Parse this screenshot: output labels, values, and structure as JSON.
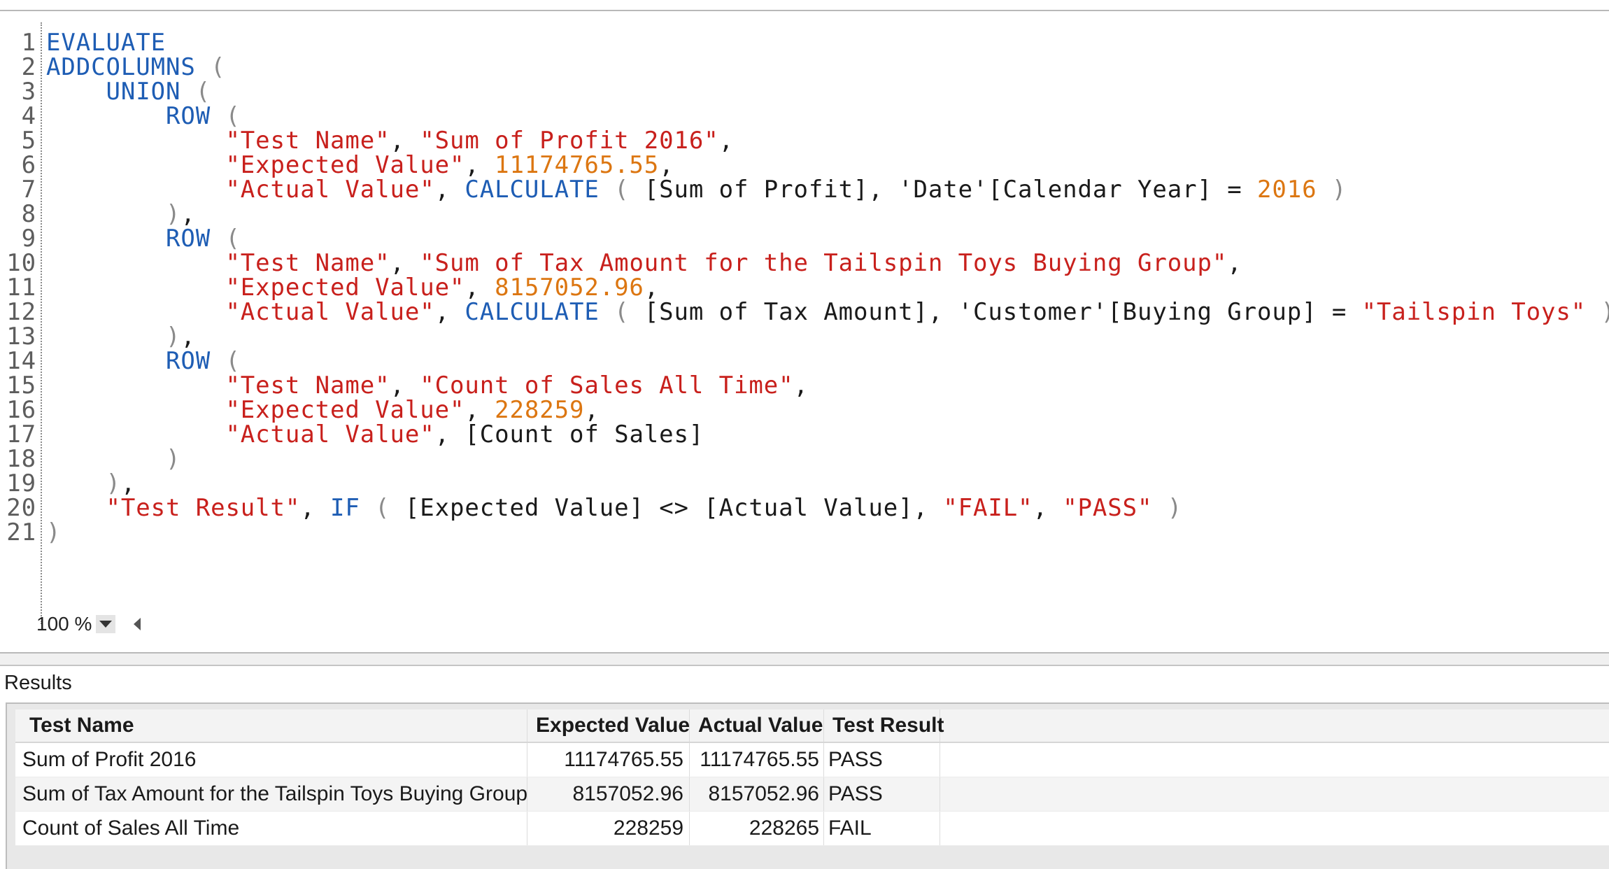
{
  "editor": {
    "lines": [
      [
        {
          "t": "EVALUATE",
          "c": "kw"
        }
      ],
      [
        {
          "t": "ADDCOLUMNS",
          "c": "kw"
        },
        {
          "t": " (",
          "c": "pg"
        }
      ],
      [
        {
          "t": "    ",
          "c": "pn"
        },
        {
          "t": "UNION",
          "c": "kw"
        },
        {
          "t": " (",
          "c": "pg"
        }
      ],
      [
        {
          "t": "        ",
          "c": "pn"
        },
        {
          "t": "ROW",
          "c": "kw"
        },
        {
          "t": " (",
          "c": "pg"
        }
      ],
      [
        {
          "t": "            ",
          "c": "pn"
        },
        {
          "t": "\"Test Name\"",
          "c": "str"
        },
        {
          "t": ", ",
          "c": "pn"
        },
        {
          "t": "\"Sum of Profit 2016\"",
          "c": "str"
        },
        {
          "t": ",",
          "c": "pn"
        }
      ],
      [
        {
          "t": "            ",
          "c": "pn"
        },
        {
          "t": "\"Expected Value\"",
          "c": "str"
        },
        {
          "t": ", ",
          "c": "pn"
        },
        {
          "t": "11174765.55",
          "c": "nm"
        },
        {
          "t": ",",
          "c": "pn"
        }
      ],
      [
        {
          "t": "            ",
          "c": "pn"
        },
        {
          "t": "\"Actual Value\"",
          "c": "str"
        },
        {
          "t": ", ",
          "c": "pn"
        },
        {
          "t": "CALCULATE",
          "c": "kw"
        },
        {
          "t": " ( ",
          "c": "pg"
        },
        {
          "t": "[Sum of Profit], 'Date'[Calendar Year] = ",
          "c": "pn"
        },
        {
          "t": "2016",
          "c": "nm"
        },
        {
          "t": " )",
          "c": "pg"
        }
      ],
      [
        {
          "t": "        ",
          "c": "pn"
        },
        {
          "t": ")",
          "c": "pg"
        },
        {
          "t": ",",
          "c": "pn"
        }
      ],
      [
        {
          "t": "        ",
          "c": "pn"
        },
        {
          "t": "ROW",
          "c": "kw"
        },
        {
          "t": " (",
          "c": "pg"
        }
      ],
      [
        {
          "t": "            ",
          "c": "pn"
        },
        {
          "t": "\"Test Name\"",
          "c": "str"
        },
        {
          "t": ", ",
          "c": "pn"
        },
        {
          "t": "\"Sum of Tax Amount for the Tailspin Toys Buying Group\"",
          "c": "str"
        },
        {
          "t": ",",
          "c": "pn"
        }
      ],
      [
        {
          "t": "            ",
          "c": "pn"
        },
        {
          "t": "\"Expected Value\"",
          "c": "str"
        },
        {
          "t": ", ",
          "c": "pn"
        },
        {
          "t": "8157052.96",
          "c": "nm"
        },
        {
          "t": ",",
          "c": "pn"
        }
      ],
      [
        {
          "t": "            ",
          "c": "pn"
        },
        {
          "t": "\"Actual Value\"",
          "c": "str"
        },
        {
          "t": ", ",
          "c": "pn"
        },
        {
          "t": "CALCULATE",
          "c": "kw"
        },
        {
          "t": " ( ",
          "c": "pg"
        },
        {
          "t": "[Sum of Tax Amount], 'Customer'[Buying Group] = ",
          "c": "pn"
        },
        {
          "t": "\"Tailspin Toys\"",
          "c": "str"
        },
        {
          "t": " )",
          "c": "pg"
        }
      ],
      [
        {
          "t": "        ",
          "c": "pn"
        },
        {
          "t": ")",
          "c": "pg"
        },
        {
          "t": ",",
          "c": "pn"
        }
      ],
      [
        {
          "t": "        ",
          "c": "pn"
        },
        {
          "t": "ROW",
          "c": "kw"
        },
        {
          "t": " (",
          "c": "pg"
        }
      ],
      [
        {
          "t": "            ",
          "c": "pn"
        },
        {
          "t": "\"Test Name\"",
          "c": "str"
        },
        {
          "t": ", ",
          "c": "pn"
        },
        {
          "t": "\"Count of Sales All Time\"",
          "c": "str"
        },
        {
          "t": ",",
          "c": "pn"
        }
      ],
      [
        {
          "t": "            ",
          "c": "pn"
        },
        {
          "t": "\"Expected Value\"",
          "c": "str"
        },
        {
          "t": ", ",
          "c": "pn"
        },
        {
          "t": "228259",
          "c": "nm"
        },
        {
          "t": ",",
          "c": "pn"
        }
      ],
      [
        {
          "t": "            ",
          "c": "pn"
        },
        {
          "t": "\"Actual Value\"",
          "c": "str"
        },
        {
          "t": ", ",
          "c": "pn"
        },
        {
          "t": "[Count of Sales]",
          "c": "pn"
        }
      ],
      [
        {
          "t": "        ",
          "c": "pn"
        },
        {
          "t": ")",
          "c": "pg"
        }
      ],
      [
        {
          "t": "    ",
          "c": "pn"
        },
        {
          "t": ")",
          "c": "pg"
        },
        {
          "t": ",",
          "c": "pn"
        }
      ],
      [
        {
          "t": "    ",
          "c": "pn"
        },
        {
          "t": "\"Test Result\"",
          "c": "str"
        },
        {
          "t": ", ",
          "c": "pn"
        },
        {
          "t": "IF",
          "c": "kw"
        },
        {
          "t": " ( ",
          "c": "pg"
        },
        {
          "t": "[Expected Value] <> [Actual Value], ",
          "c": "pn"
        },
        {
          "t": "\"FAIL\"",
          "c": "str"
        },
        {
          "t": ", ",
          "c": "pn"
        },
        {
          "t": "\"PASS\"",
          "c": "str"
        },
        {
          "t": " )",
          "c": "pg"
        }
      ],
      [
        {
          "t": ")",
          "c": "pg"
        }
      ]
    ],
    "zoom": "100 %"
  },
  "results": {
    "title": "Results",
    "columns": [
      "Test Name",
      "Expected Value",
      "Actual Value",
      "Test Result"
    ],
    "rows": [
      [
        "Sum of Profit 2016",
        "11174765.55",
        "11174765.55",
        "PASS"
      ],
      [
        "Sum of Tax Amount for the Tailspin Toys Buying Group",
        "8157052.96",
        "8157052.96",
        "PASS"
      ],
      [
        "Count of Sales All Time",
        "228259",
        "228265",
        "FAIL"
      ]
    ]
  }
}
